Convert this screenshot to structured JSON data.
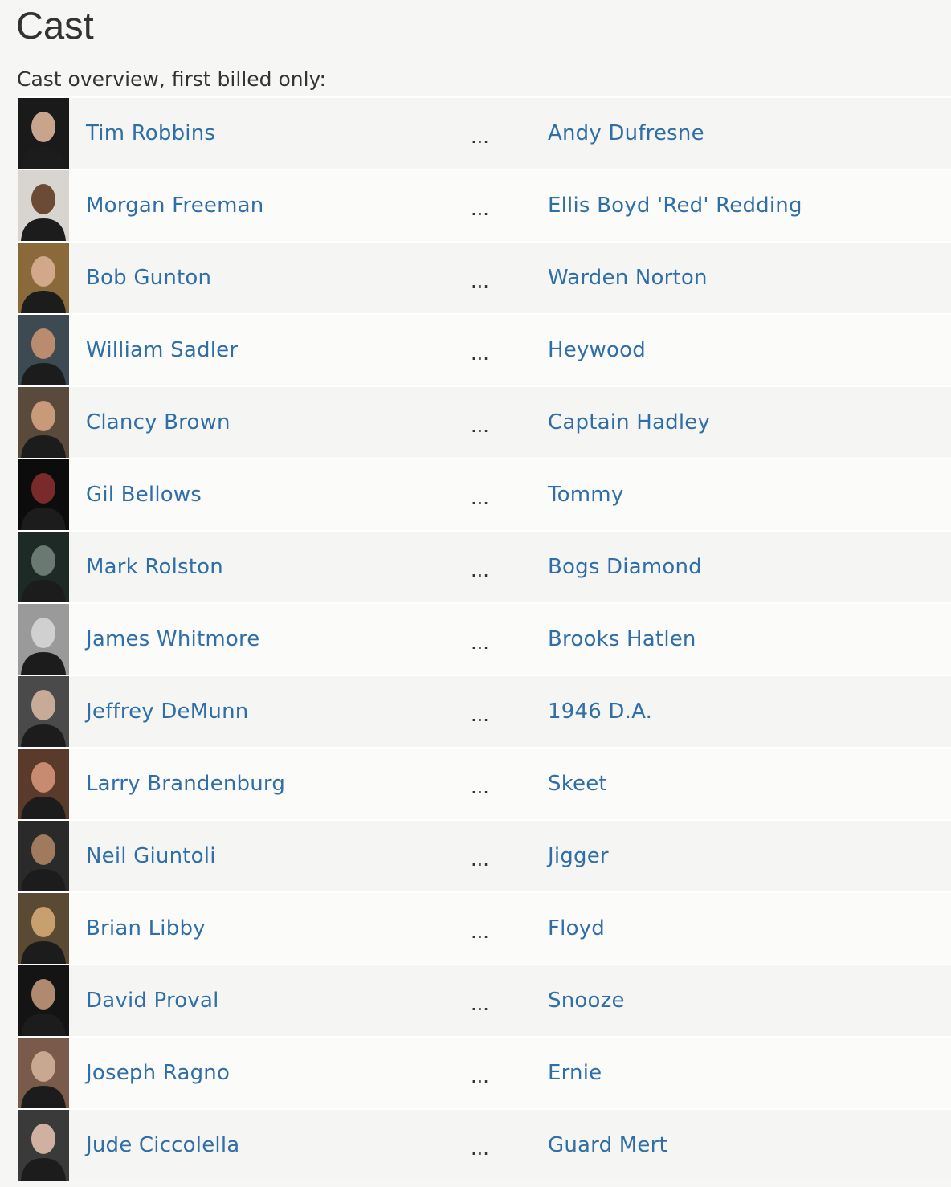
{
  "section": {
    "title": "Cast",
    "overview_label": "Cast overview, first billed only:"
  },
  "cast": [
    {
      "actor": "Tim Robbins",
      "separator": "...",
      "character": "Andy Dufresne",
      "photo_icon": "headshot-photo",
      "tone": "#1a1a1a",
      "skin": "#c9a48c"
    },
    {
      "actor": "Morgan Freeman",
      "separator": "...",
      "character": "Ellis Boyd 'Red' Redding",
      "photo_icon": "headshot-photo",
      "tone": "#d8d4d0",
      "skin": "#6b4a36"
    },
    {
      "actor": "Bob Gunton",
      "separator": "...",
      "character": "Warden Norton",
      "photo_icon": "headshot-photo",
      "tone": "#8a6a3a",
      "skin": "#d2a88a"
    },
    {
      "actor": "William Sadler",
      "separator": "...",
      "character": "Heywood",
      "photo_icon": "headshot-photo",
      "tone": "#3e4a52",
      "skin": "#b98c70"
    },
    {
      "actor": "Clancy Brown",
      "separator": "...",
      "character": "Captain Hadley",
      "photo_icon": "headshot-photo",
      "tone": "#5a4a3c",
      "skin": "#c89a7a"
    },
    {
      "actor": "Gil Bellows",
      "separator": "...",
      "character": "Tommy",
      "photo_icon": "headshot-photo",
      "tone": "#0c0c0c",
      "skin": "#7a2a2a"
    },
    {
      "actor": "Mark Rolston",
      "separator": "...",
      "character": "Bogs Diamond",
      "photo_icon": "headshot-photo",
      "tone": "#1e2a26",
      "skin": "#6a7a72"
    },
    {
      "actor": "James Whitmore",
      "separator": "...",
      "character": "Brooks Hatlen",
      "photo_icon": "headshot-photo",
      "tone": "#9a9a9a",
      "skin": "#d0d0d0"
    },
    {
      "actor": "Jeffrey DeMunn",
      "separator": "...",
      "character": "1946 D.A.",
      "photo_icon": "headshot-photo",
      "tone": "#4a4a4a",
      "skin": "#c8aa98"
    },
    {
      "actor": "Larry Brandenburg",
      "separator": "...",
      "character": "Skeet",
      "photo_icon": "headshot-photo",
      "tone": "#5a3a2a",
      "skin": "#c88a70"
    },
    {
      "actor": "Neil Giuntoli",
      "separator": "...",
      "character": "Jigger",
      "photo_icon": "headshot-photo",
      "tone": "#2a2a2a",
      "skin": "#a07a5e"
    },
    {
      "actor": "Brian Libby",
      "separator": "...",
      "character": "Floyd",
      "photo_icon": "headshot-photo",
      "tone": "#5a4a34",
      "skin": "#c8a070"
    },
    {
      "actor": "David Proval",
      "separator": "...",
      "character": "Snooze",
      "photo_icon": "headshot-photo",
      "tone": "#141414",
      "skin": "#b08a70"
    },
    {
      "actor": "Joseph Ragno",
      "separator": "...",
      "character": "Ernie",
      "photo_icon": "headshot-photo",
      "tone": "#7a5a4a",
      "skin": "#c8a890"
    },
    {
      "actor": "Jude Ciccolella",
      "separator": "...",
      "character": "Guard Mert",
      "photo_icon": "headshot-photo",
      "tone": "#3a3a3a",
      "skin": "#d0b0a0"
    }
  ]
}
